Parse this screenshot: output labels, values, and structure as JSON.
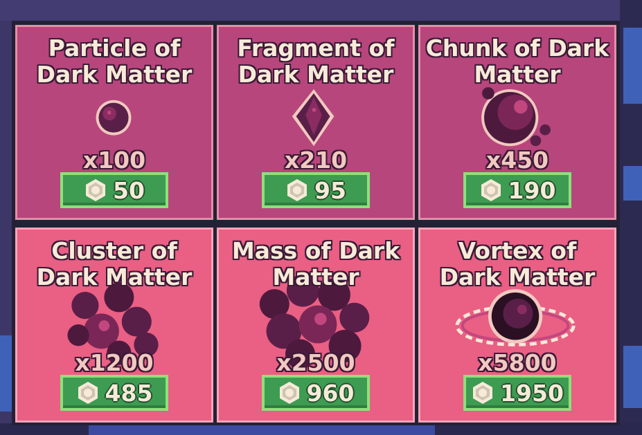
{
  "shop": {
    "items": [
      {
        "title": "Particle of\nDark Matter",
        "quantity": "x100",
        "price": "50",
        "icon": "dark-matter-particle-icon"
      },
      {
        "title": "Fragment of\nDark Matter",
        "quantity": "x210",
        "price": "95",
        "icon": "dark-matter-fragment-icon"
      },
      {
        "title": "Chunk of Dark\nMatter",
        "quantity": "x450",
        "price": "190",
        "icon": "dark-matter-chunk-icon"
      },
      {
        "title": "Cluster of\nDark Matter",
        "quantity": "x1200",
        "price": "485",
        "icon": "dark-matter-cluster-icon"
      },
      {
        "title": "Mass of Dark\nMatter",
        "quantity": "x2500",
        "price": "960",
        "icon": "dark-matter-mass-icon"
      },
      {
        "title": "Vortex of\nDark Matter",
        "quantity": "x5800",
        "price": "1950",
        "icon": "dark-matter-vortex-icon"
      }
    ],
    "currency_icon": "coin-icon",
    "colors": {
      "card_row1": "#b7467c",
      "card_row2": "#ea5f84",
      "price_button": "#3e9b52",
      "background": "#3d3768"
    }
  }
}
